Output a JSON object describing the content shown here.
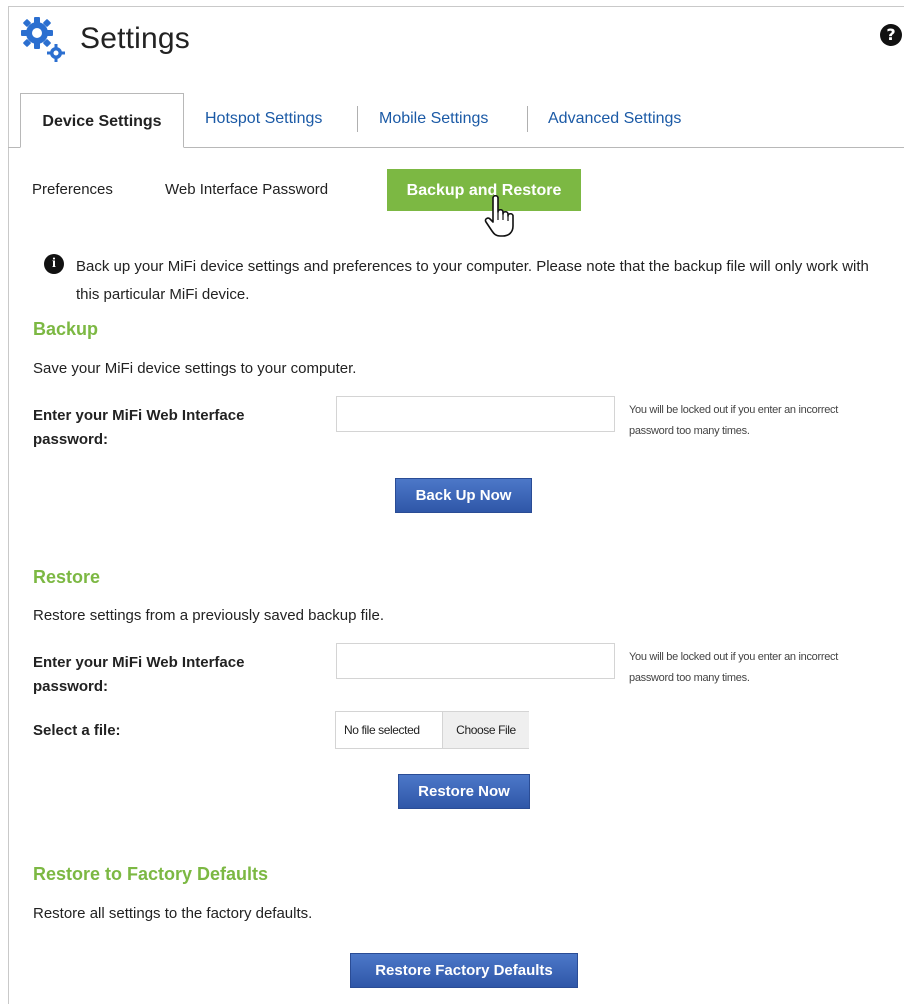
{
  "header": {
    "title": "Settings",
    "gear_icon": "gear-icon",
    "help_icon": "help-icon"
  },
  "tabs": [
    {
      "label": "Device Settings",
      "active": true
    },
    {
      "label": "Hotspot Settings",
      "active": false
    },
    {
      "label": "Mobile Settings",
      "active": false
    },
    {
      "label": "Advanced Settings",
      "active": false
    }
  ],
  "subtabs": [
    {
      "label": "Preferences",
      "active": false
    },
    {
      "label": "Web Interface Password",
      "active": false
    },
    {
      "label": "Backup and Restore",
      "active": true
    }
  ],
  "info": {
    "icon": "info-icon",
    "text": "Back up your MiFi device settings and preferences to your computer. Please note that the backup file will only work with this particular MiFi device."
  },
  "backup": {
    "heading": "Backup",
    "description": "Save your MiFi device settings to your computer.",
    "password_label": "Enter your MiFi Web Interface password:",
    "password_value": "",
    "note": "You will be locked out if you enter an incorrect password too many times.",
    "button": "Back Up Now"
  },
  "restore": {
    "heading": "Restore",
    "description": "Restore settings from a previously saved backup file.",
    "password_label": "Enter your MiFi Web Interface password:",
    "password_value": "",
    "note": "You will be locked out if you enter an incorrect password too many times.",
    "file_label": "Select a file:",
    "file_status": "No file selected",
    "file_button": "Choose File",
    "button": "Restore Now"
  },
  "factory": {
    "heading": "Restore to Factory Defaults",
    "description": "Restore all settings to the factory defaults.",
    "button": "Restore Factory Defaults"
  },
  "colors": {
    "accent_green": "#7cb843",
    "button_blue": "#2f57a8",
    "link_blue": "#1b5aa6"
  }
}
